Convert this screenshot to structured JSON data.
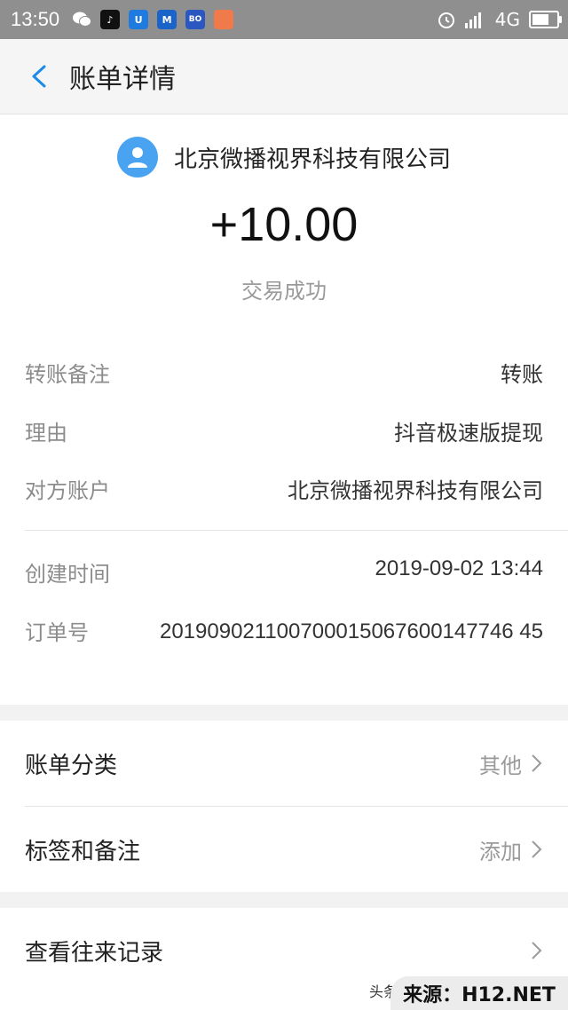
{
  "statusbar": {
    "time": "13:50",
    "network": "4G",
    "apps": [
      {
        "icon": "wechat-icon",
        "label": ""
      },
      {
        "icon": "tiktok-icon",
        "label": "♪"
      },
      {
        "icon": "app-u-icon",
        "label": "U"
      },
      {
        "icon": "app-m-icon",
        "label": "M"
      },
      {
        "icon": "app-bolb-icon",
        "label": "BO"
      },
      {
        "icon": "app-orange-icon",
        "label": ""
      }
    ]
  },
  "nav": {
    "title": "账单详情"
  },
  "header": {
    "payee": "北京微播视界科技有限公司",
    "amount": "+10.00",
    "status": "交易成功"
  },
  "details": {
    "remark_label": "转账备注",
    "remark_value": "转账",
    "reason_label": "理由",
    "reason_value": "抖音极速版提现",
    "account_label": "对方账户",
    "account_value": "北京微播视界科技有限公司",
    "created_label": "创建时间",
    "created_value": "2019-09-02 13:44",
    "order_label": "订单号",
    "order_value": "201909021100700015067600147746 45"
  },
  "menu": {
    "category_label": "账单分类",
    "category_value": "其他",
    "tags_label": "标签和备注",
    "tags_value": "添加",
    "history_label": "查看往来记录"
  },
  "watermark": {
    "source": "来源：H12.NET",
    "toutiao": "头条"
  },
  "colors": {
    "accent": "#1a8be8",
    "avatar": "#4aa3f0",
    "statusbar": "#8f8f8f"
  }
}
